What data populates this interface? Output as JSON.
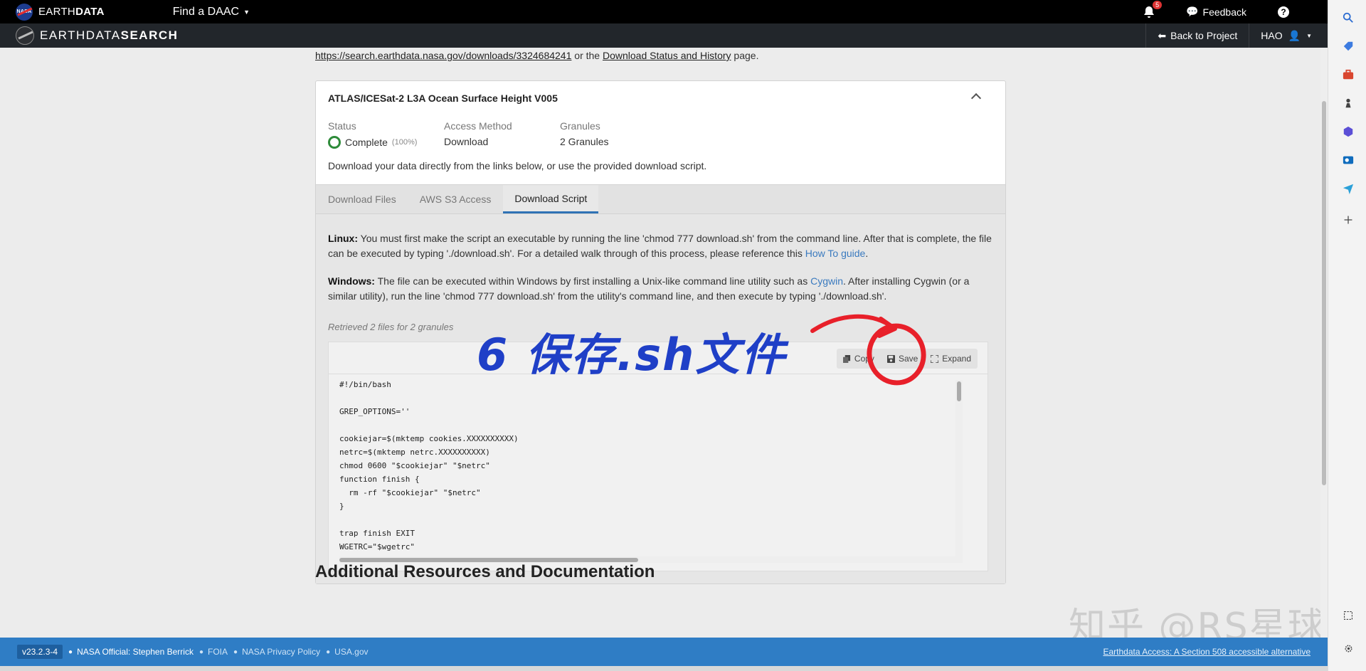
{
  "top_bar": {
    "brand_prefix": "EARTH",
    "brand_suffix": "DATA",
    "find_daac": "Find a DAAC",
    "notification_count": "5",
    "feedback": "Feedback",
    "help": "?"
  },
  "search_bar": {
    "brand_prefix": "EARTHDATA",
    "brand_suffix": "SEARCH",
    "back_to_project": "Back to Project",
    "user": "HAO"
  },
  "content": {
    "link_url": "https://search.earthdata.nasa.gov/downloads/3324684241",
    "link_mid": " or the ",
    "status_link": "Download Status and History",
    "link_tail": " page."
  },
  "card": {
    "title": "ATLAS/ICESat-2 L3A Ocean Surface Height V005",
    "status_label": "Status",
    "status_value": "Complete",
    "status_pct": "(100%)",
    "access_label": "Access Method",
    "access_value": "Download",
    "granules_label": "Granules",
    "granules_value": "2 Granules",
    "description": "Download your data directly from the links below, or use the provided download script.",
    "tabs": [
      {
        "label": "Download Files"
      },
      {
        "label": "AWS S3 Access"
      },
      {
        "label": "Download Script"
      }
    ],
    "active_tab": "Download Script",
    "linux_label": "Linux:",
    "linux_text": " You must first make the script an executable by running the line 'chmod 777 download.sh' from the command line. After that is complete, the file can be executed by typing './download.sh'. For a detailed walk through of this process, please reference this ",
    "linux_link": "How To guide",
    "linux_end": ".",
    "windows_label": "Windows:",
    "windows_text": " The file can be executed within Windows by first installing a Unix-like command line utility such as ",
    "windows_link": "Cygwin",
    "windows_text2": ". After installing Cygwin (or a similar utility), run the line 'chmod 777 download.sh' from the utility's command line, and then execute by typing './download.sh'.",
    "retrieved": "Retrieved 2 files for 2 granules",
    "copy_label": "Copy",
    "save_label": "Save",
    "expand_label": "Expand",
    "code_lines": [
      "#!/bin/bash",
      "",
      "GREP_OPTIONS=''",
      "",
      "cookiejar=$(mktemp cookies.XXXXXXXXXX)",
      "netrc=$(mktemp netrc.XXXXXXXXXX)",
      "chmod 0600 \"$cookiejar\" \"$netrc\"",
      "function finish {",
      "  rm -rf \"$cookiejar\" \"$netrc\"",
      "}",
      "",
      "trap finish EXIT",
      "WGETRC=\"$wgetrc\""
    ]
  },
  "section_heading": "Additional Resources and Documentation",
  "annotation": "6 保存.sh文件",
  "watermark": "知乎 @RS星球",
  "footer": {
    "version": "v23.2.3-4",
    "official": "NASA Official: Stephen Berrick",
    "foia": "FOIA",
    "privacy": "NASA Privacy Policy",
    "usagov": "USA.gov",
    "accessible": "Earthdata Access: A Section 508 accessible alternative"
  },
  "colors": {
    "accent": "#2f72b5",
    "footer": "#2f7dc5",
    "annotation_blue": "#1f3fc7",
    "annotation_red": "#e8202a",
    "complete_green": "#2e8b3a"
  },
  "edge_icons": [
    "search-icon",
    "tag-icon",
    "briefcase-icon",
    "chess-icon",
    "hexagon-icon",
    "outlook-icon",
    "send-icon",
    "plus-icon",
    "screenshot-icon",
    "settings-icon"
  ]
}
